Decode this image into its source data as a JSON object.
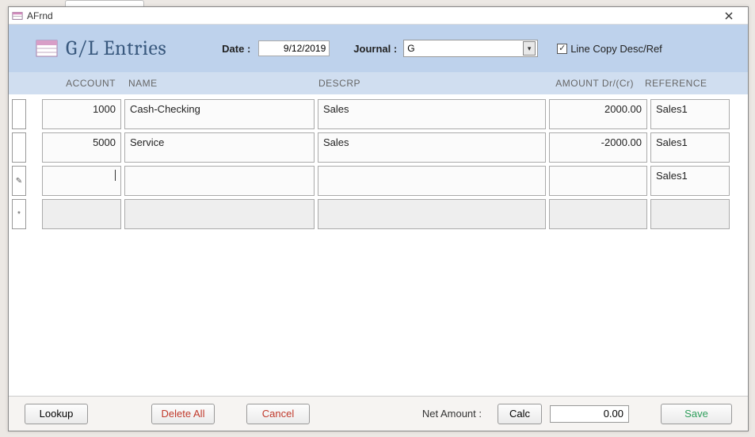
{
  "window": {
    "title": "AFrnd"
  },
  "header": {
    "title": "G/L Entries",
    "date_label": "Date   :",
    "date_value": "9/12/2019",
    "journal_label": "Journal  :",
    "journal_value": "G",
    "linecopy_label": "Line Copy Desc/Ref",
    "linecopy_checked": "✓"
  },
  "columns": {
    "account": "ACCOUNT",
    "name": "NAME",
    "descrp": "DESCRP",
    "amount": "AMOUNT Dr/(Cr)",
    "reference": "REFERENCE"
  },
  "rows": [
    {
      "sel": "",
      "account": "1000",
      "name": "Cash-Checking",
      "descrp": "Sales",
      "amount": "2000.00",
      "reference": "Sales1",
      "disabled": false
    },
    {
      "sel": "",
      "account": "5000",
      "name": "Service",
      "descrp": "Sales",
      "amount": "-2000.00",
      "reference": "Sales1",
      "disabled": false
    },
    {
      "sel": "✎",
      "account": "",
      "name": "",
      "descrp": "",
      "amount": "",
      "reference": "Sales1",
      "disabled": false,
      "editing": true
    },
    {
      "sel": "*",
      "account": "",
      "name": "",
      "descrp": "",
      "amount": "",
      "reference": "",
      "disabled": true
    }
  ],
  "footer": {
    "lookup": "Lookup",
    "delete_all": "Delete All",
    "cancel": "Cancel",
    "net_label": "Net Amount :",
    "calc": "Calc",
    "net_value": "0.00",
    "save": "Save"
  }
}
